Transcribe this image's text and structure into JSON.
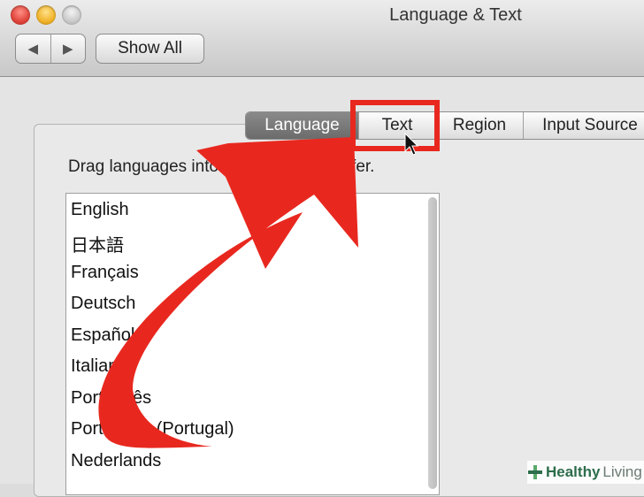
{
  "window": {
    "title": "Language & Text"
  },
  "toolbar": {
    "back_glyph": "◀",
    "forward_glyph": "▶",
    "show_all_label": "Show All"
  },
  "tabs": [
    {
      "label": "Language",
      "selected": true
    },
    {
      "label": "Text",
      "selected": false
    },
    {
      "label": "Region",
      "selected": false
    },
    {
      "label": "Input Source",
      "selected": false
    }
  ],
  "hint_text": "Drag languages into the order you prefer.",
  "languages": [
    "English",
    "日本語",
    "Français",
    "Deutsch",
    "Español",
    "Italiano",
    "Português",
    "Português (Portugal)",
    "Nederlands"
  ],
  "annotation": {
    "color": "#e8281f",
    "target": "Text"
  },
  "watermark": {
    "brand_bold": "Healthy",
    "brand_light": "Living"
  }
}
